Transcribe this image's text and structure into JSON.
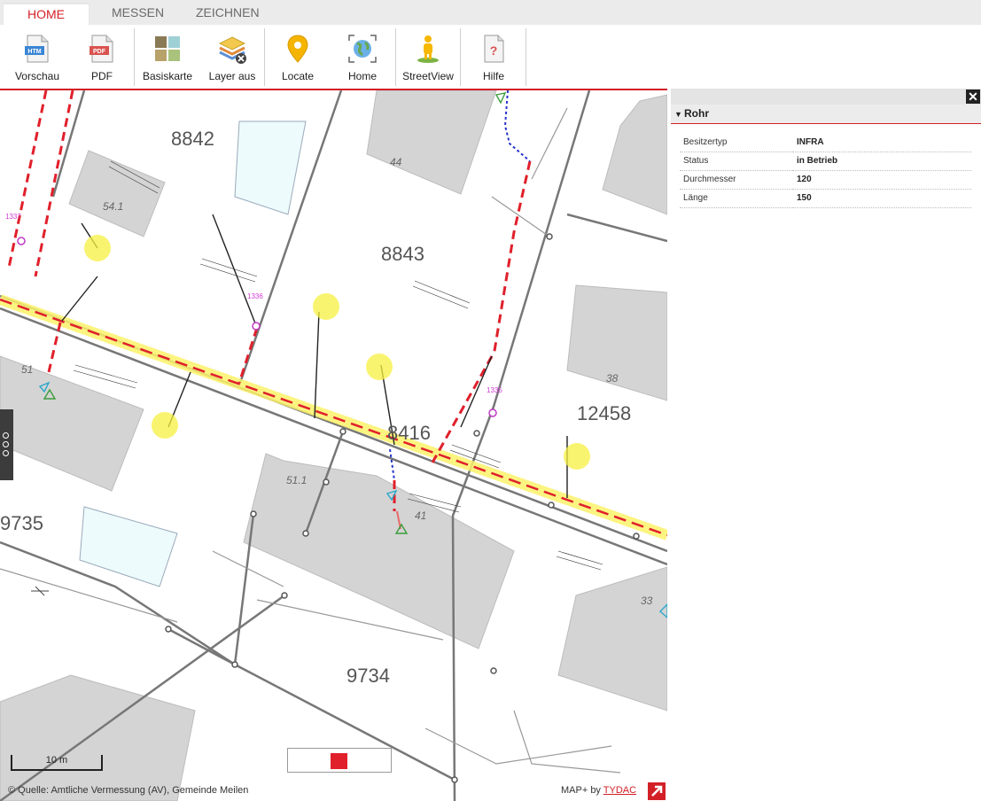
{
  "tabs": [
    {
      "label": "HOME",
      "active": true
    },
    {
      "label": "MESSEN",
      "active": false
    },
    {
      "label": "ZEICHNEN",
      "active": false
    }
  ],
  "toolbar": {
    "preview": {
      "label": "Vorschau",
      "icon": "htm-file-icon",
      "badge": "HTM"
    },
    "pdf": {
      "label": "PDF",
      "icon": "pdf-file-icon",
      "badge": "PDF"
    },
    "basemap": {
      "label": "Basiskarte",
      "icon": "basemap-tiles-icon"
    },
    "layers_off": {
      "label": "Layer aus",
      "icon": "layers-off-icon"
    },
    "locate": {
      "label": "Locate",
      "icon": "location-pin-icon"
    },
    "home": {
      "label": "Home",
      "icon": "globe-extent-icon"
    },
    "streetview": {
      "label": "StreetView",
      "icon": "pegman-icon"
    },
    "help": {
      "label": "Hilfe",
      "icon": "help-document-icon",
      "badge": "?"
    }
  },
  "map": {
    "parcel_numbers": [
      "8842",
      "8843",
      "8416",
      "12458",
      "9735",
      "9734"
    ],
    "building_labels": [
      "54.1",
      "44",
      "51",
      "51.1",
      "41",
      "38",
      "33"
    ],
    "node_labels": [
      "1337",
      "1336",
      "1335"
    ],
    "scale_bar": "10 m",
    "copyright": "© Quelle: Amtliche Vermessung (AV), Gemeinde Meilen",
    "credit_prefix": "MAP+ by",
    "credit_link": "TYDAC",
    "highlight_color": "#e0202b"
  },
  "feature_panel": {
    "title": "Rohr",
    "attributes": [
      {
        "key": "Besitzertyp",
        "value": "INFRA"
      },
      {
        "key": "Status",
        "value": "in Betrieb"
      },
      {
        "key": "Durchmesser",
        "value": "120"
      },
      {
        "key": "Länge",
        "value": "150"
      }
    ]
  }
}
